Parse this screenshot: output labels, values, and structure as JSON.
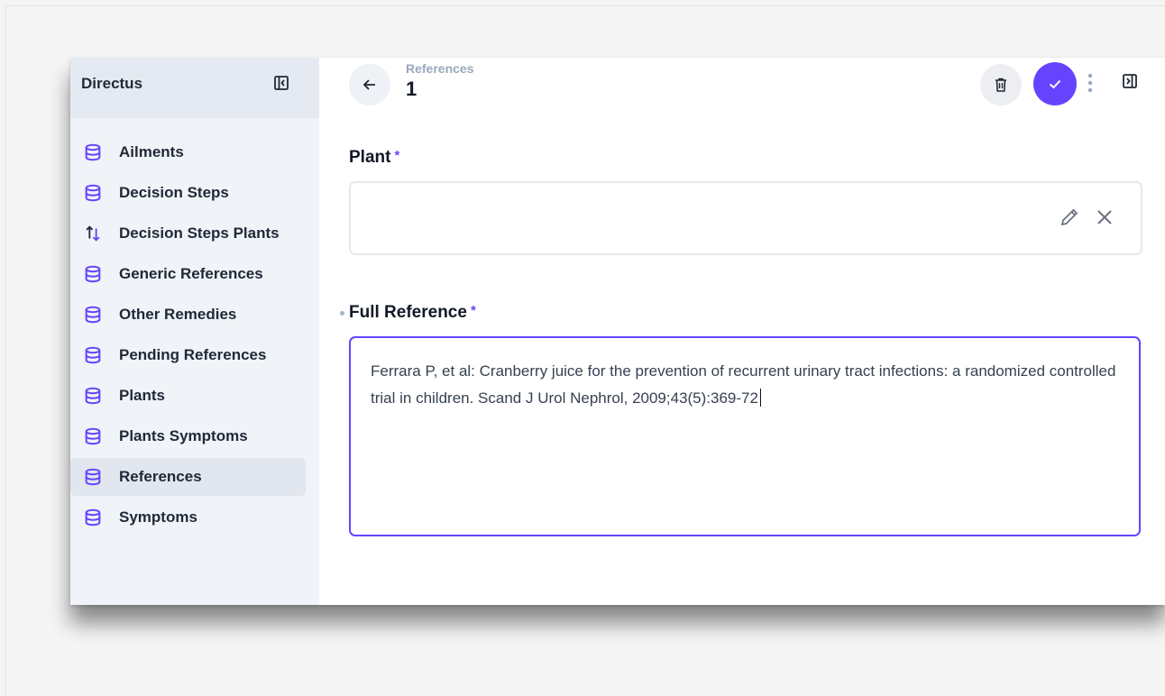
{
  "app": {
    "name": "Directus"
  },
  "sidebar": {
    "items": [
      {
        "label": "Ailments",
        "icon": "database-icon",
        "active": false
      },
      {
        "label": "Decision Steps",
        "icon": "database-icon",
        "active": false
      },
      {
        "label": "Decision Steps Plants",
        "icon": "import-export-icon",
        "active": false
      },
      {
        "label": "Generic References",
        "icon": "database-icon",
        "active": false
      },
      {
        "label": "Other Remedies",
        "icon": "database-icon",
        "active": false
      },
      {
        "label": "Pending References",
        "icon": "database-icon",
        "active": false
      },
      {
        "label": "Plants",
        "icon": "database-icon",
        "active": false
      },
      {
        "label": "Plants Symptoms",
        "icon": "database-icon",
        "active": false
      },
      {
        "label": "References",
        "icon": "database-icon",
        "active": true
      },
      {
        "label": "Symptoms",
        "icon": "database-icon",
        "active": false
      }
    ]
  },
  "header": {
    "breadcrumb": "References",
    "title": "1"
  },
  "form": {
    "plant": {
      "label": "Plant",
      "required_mark": "*",
      "value": ""
    },
    "full_reference": {
      "label": "Full Reference",
      "required_mark": "*",
      "value": "Ferrara P, et al: Cranberry juice for the prevention of recurrent urinary tract infections: a randomized controlled trial in children. Scand J Urol Nephrol, 2009;43(5):369-72"
    }
  },
  "colors": {
    "accent": "#6644ff",
    "sidebar_bg": "#f0f3f8",
    "sidebar_header_bg": "#e5eaf2",
    "active_item_bg": "#e1e6ef"
  }
}
